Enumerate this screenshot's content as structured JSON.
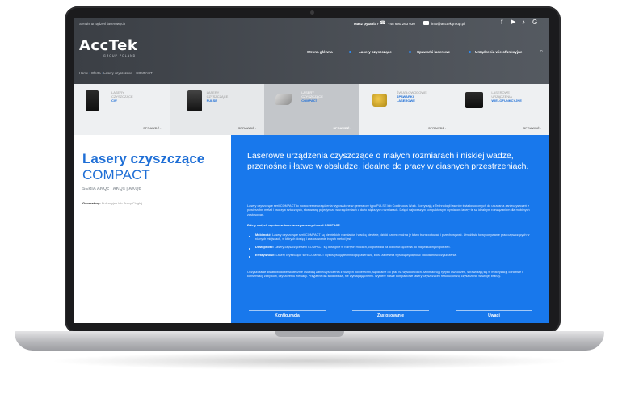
{
  "topbar": {
    "service": "Serwis urządzeń laserowych",
    "question": "Masz pytania?",
    "phone": "+48 690 263 030",
    "email": "info@acctekgroup.pl",
    "social": [
      "f",
      "▶",
      "♪",
      "G"
    ]
  },
  "brand": {
    "logo": "AccTek",
    "sub": "GROUP POLAND"
  },
  "nav": {
    "items": [
      "Strona główna",
      "Lasery czyszczące",
      "Spawarki laserowe",
      "Urządzenia wielofunkcyjne"
    ],
    "search_icon": "search-icon"
  },
  "breadcrumb": [
    "Home",
    "Oferta",
    "Lasery czyszczące – COMPACT"
  ],
  "cards": [
    {
      "l1": "LASERY",
      "l2": "CZYSZCZĄCE",
      "l3": "CW",
      "cta": "SPRAWDŹ ›"
    },
    {
      "l1": "LASERY",
      "l2": "CZYSZCZĄCE",
      "l3": "PULSE",
      "cta": "SPRAWDŹ ›"
    },
    {
      "l1": "LASERY",
      "l2": "CZYSZCZĄCE",
      "l3": "COMPACT",
      "cta": "SPRAWDŹ ›"
    },
    {
      "l1": "ŚWIATŁOWODOWE",
      "l2": "SPAWARKI",
      "l3": "LASEROWE",
      "cta": "SPRAWDŹ ›"
    },
    {
      "l1": "LASEROWE",
      "l2": "URZĄDZENIA",
      "l3": "WIELOFUNKCYJNE",
      "cta": "SPRAWDŹ ›"
    }
  ],
  "product": {
    "title1": "Lasery czyszczące",
    "title2": "COMPACT",
    "seria": "SERIA AKQc | AKQs | AKQb",
    "gen_label": "Generatory:",
    "gen_value": "Pulsacyjne lub Pracy Ciągłej"
  },
  "content": {
    "lead": "Laserowe urządzenia czyszczące o małych rozmiarach i niskiej wadze, przenośne i łatwe w obsłudze, idealne do pracy w ciasnych przestrzeniach.",
    "p1": "Lasery czyszczące serii COMPACT to nowoczesne urządzenia wyposażone w generatory typu PULSE lub Continuous Work. Korzystają z Technologii laserów światłowodowych do usuwania zanieczyszczeń z powierzchni metali i tworzyw sztucznych, stosowaną pojedynczo w urządzeniach o dużo większych rozmiarach. Dzięki najnowszym kompaktowym wymiarom lasery te są idealnym rozwiązaniem dla mobilnych zastosowań.",
    "p2": "Zalety małych wymiarów laserów czyszczących serii COMPACT:",
    "b1_t": "Mobilność:",
    "b1": "Lasery czyszczące serii COMPACT są niewielkich rozmiarów i wadzą niewiele, dzięki czemu można je łatwo transportować i przechowywać. Umożliwia to wykonywanie prac czyszczących w różnych miejscach, w których dostęp i zastosowanie innych metod jest",
    "b2_t": "Dostępność:",
    "b2": "Lasery czyszczące serii COMPACT są dostępne w różnych mocach, co pozwala na dobór urządzenia do indywidualnych potrzeb.",
    "b3_t": "Efektywność:",
    "b3": "Lasery czyszczące serii COMPACT wykorzystują technologię laserową, która zapewnia wysoką wydajność i dokładność czyszczenia.",
    "p3": "Oczyszczanie światłowodowe skutecznie usuwają zanieczyszczenia z różnych powierzchni, są idealne do prac na wysokościach. Minimalizują ryzyko uszkodzeń, sprawdzają się w motoryzacji, lotnictwie i konserwacji zabytków, czyszczeniu elewacji. Przyjazne dla środowiska, nie wymagają chemii. Wybierz nasze kompaktowe lasery czyszczące i rewolucjonizuj czyszczenie w swojej branży."
  },
  "tabs": [
    "Konfiguracja",
    "Zastosowanie",
    "Uwagi"
  ],
  "colors": {
    "accent": "#1878ec",
    "header": "#44484e"
  }
}
